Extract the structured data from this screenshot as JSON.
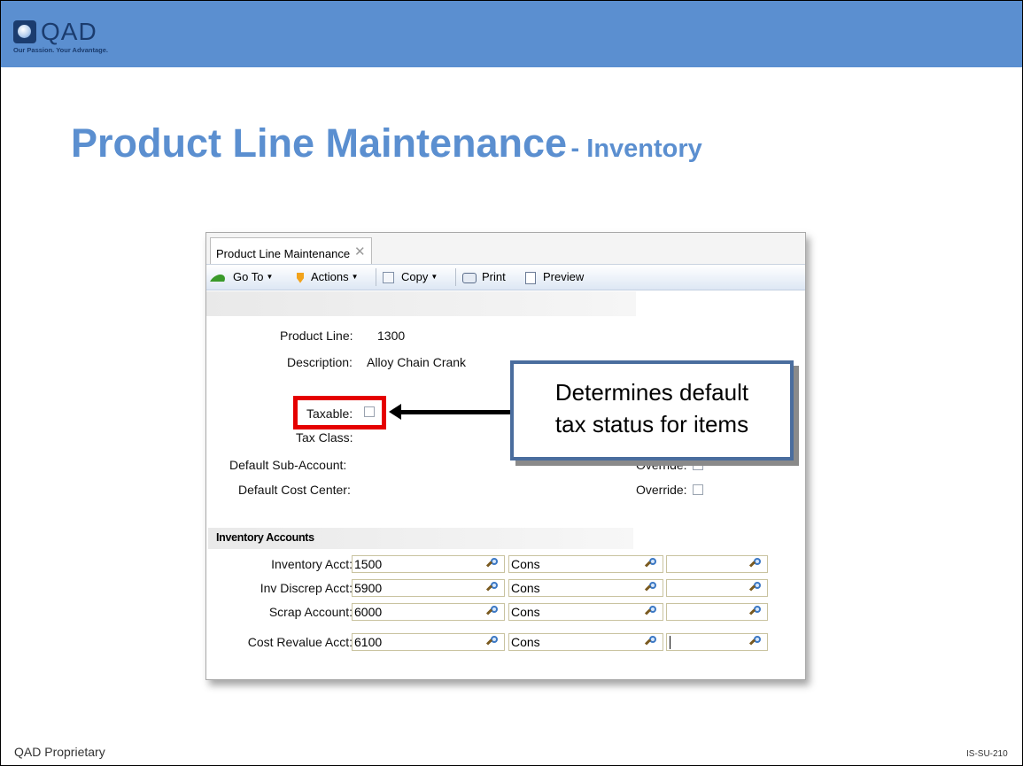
{
  "logo": {
    "name": "QAD",
    "tagline": "Our Passion. Your Advantage."
  },
  "slide": {
    "title": "Product Line Maintenance",
    "subtitle": "- Inventory"
  },
  "app": {
    "tab_label": "Product Line Maintenance",
    "tab_close": "✕",
    "toolbar": {
      "goto": "Go To",
      "actions": "Actions",
      "copy": "Copy",
      "print": "Print",
      "preview": "Preview",
      "caret": "▼"
    },
    "form": {
      "product_line_label": "Product Line:",
      "product_line_value": "1300",
      "description_label": "Description:",
      "description_value": "Alloy Chain Crank",
      "taxable_label": "Taxable:",
      "taxable_checked": false,
      "tax_class_label": "Tax Class:",
      "sub_account_label": "Default Sub-Account:",
      "override_label_1": "Override:",
      "cost_center_label": "Default Cost Center:",
      "override_label_2": "Override:"
    },
    "callout": {
      "line1": "Determines default",
      "line2": "tax status for items"
    },
    "section_title": "Inventory Accounts",
    "accounts": [
      {
        "label": "Inventory Acct:",
        "account": "1500",
        "sub": "Cons",
        "cc": ""
      },
      {
        "label": "Inv Discrep Acct:",
        "account": "5900",
        "sub": "Cons",
        "cc": ""
      },
      {
        "label": "Scrap Account:",
        "account": "6000",
        "sub": "Cons",
        "cc": ""
      },
      {
        "label": "Cost Revalue Acct:",
        "account": "6100",
        "sub": "Cons",
        "cc": ""
      }
    ]
  },
  "footer": {
    "left": "QAD Proprietary",
    "right": "IS-SU-210"
  },
  "colors": {
    "banner": "#5b8fd0",
    "title": "#5b8fd0",
    "highlight": "#e50000",
    "callout_border": "#4a6d9e"
  }
}
